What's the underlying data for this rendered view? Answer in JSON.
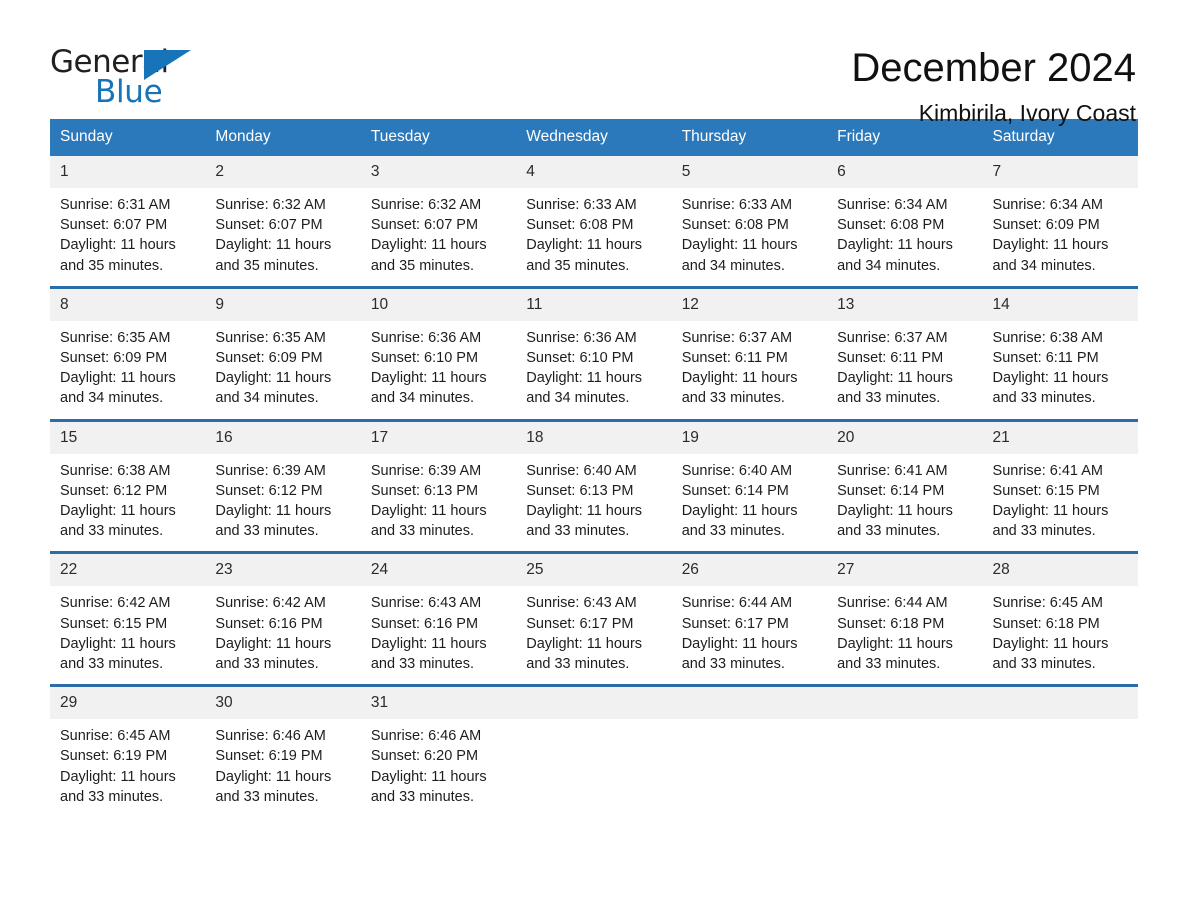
{
  "brand": {
    "name_part1": "General",
    "name_part2": "Blue",
    "triangle_icon": "triangle-icon",
    "accent_color": "#1874b8"
  },
  "header": {
    "title": "December 2024",
    "location": "Kimbirila, Ivory Coast"
  },
  "calendar": {
    "header_bg": "#2b78ba",
    "row_divider_color": "#2b6ca8",
    "daynum_bg": "#f1f1f1",
    "weekday_headers": [
      "Sunday",
      "Monday",
      "Tuesday",
      "Wednesday",
      "Thursday",
      "Friday",
      "Saturday"
    ],
    "weeks": [
      [
        {
          "day": "1",
          "sunrise": "Sunrise: 6:31 AM",
          "sunset": "Sunset: 6:07 PM",
          "daylight": "Daylight: 11 hours and 35 minutes."
        },
        {
          "day": "2",
          "sunrise": "Sunrise: 6:32 AM",
          "sunset": "Sunset: 6:07 PM",
          "daylight": "Daylight: 11 hours and 35 minutes."
        },
        {
          "day": "3",
          "sunrise": "Sunrise: 6:32 AM",
          "sunset": "Sunset: 6:07 PM",
          "daylight": "Daylight: 11 hours and 35 minutes."
        },
        {
          "day": "4",
          "sunrise": "Sunrise: 6:33 AM",
          "sunset": "Sunset: 6:08 PM",
          "daylight": "Daylight: 11 hours and 35 minutes."
        },
        {
          "day": "5",
          "sunrise": "Sunrise: 6:33 AM",
          "sunset": "Sunset: 6:08 PM",
          "daylight": "Daylight: 11 hours and 34 minutes."
        },
        {
          "day": "6",
          "sunrise": "Sunrise: 6:34 AM",
          "sunset": "Sunset: 6:08 PM",
          "daylight": "Daylight: 11 hours and 34 minutes."
        },
        {
          "day": "7",
          "sunrise": "Sunrise: 6:34 AM",
          "sunset": "Sunset: 6:09 PM",
          "daylight": "Daylight: 11 hours and 34 minutes."
        }
      ],
      [
        {
          "day": "8",
          "sunrise": "Sunrise: 6:35 AM",
          "sunset": "Sunset: 6:09 PM",
          "daylight": "Daylight: 11 hours and 34 minutes."
        },
        {
          "day": "9",
          "sunrise": "Sunrise: 6:35 AM",
          "sunset": "Sunset: 6:09 PM",
          "daylight": "Daylight: 11 hours and 34 minutes."
        },
        {
          "day": "10",
          "sunrise": "Sunrise: 6:36 AM",
          "sunset": "Sunset: 6:10 PM",
          "daylight": "Daylight: 11 hours and 34 minutes."
        },
        {
          "day": "11",
          "sunrise": "Sunrise: 6:36 AM",
          "sunset": "Sunset: 6:10 PM",
          "daylight": "Daylight: 11 hours and 34 minutes."
        },
        {
          "day": "12",
          "sunrise": "Sunrise: 6:37 AM",
          "sunset": "Sunset: 6:11 PM",
          "daylight": "Daylight: 11 hours and 33 minutes."
        },
        {
          "day": "13",
          "sunrise": "Sunrise: 6:37 AM",
          "sunset": "Sunset: 6:11 PM",
          "daylight": "Daylight: 11 hours and 33 minutes."
        },
        {
          "day": "14",
          "sunrise": "Sunrise: 6:38 AM",
          "sunset": "Sunset: 6:11 PM",
          "daylight": "Daylight: 11 hours and 33 minutes."
        }
      ],
      [
        {
          "day": "15",
          "sunrise": "Sunrise: 6:38 AM",
          "sunset": "Sunset: 6:12 PM",
          "daylight": "Daylight: 11 hours and 33 minutes."
        },
        {
          "day": "16",
          "sunrise": "Sunrise: 6:39 AM",
          "sunset": "Sunset: 6:12 PM",
          "daylight": "Daylight: 11 hours and 33 minutes."
        },
        {
          "day": "17",
          "sunrise": "Sunrise: 6:39 AM",
          "sunset": "Sunset: 6:13 PM",
          "daylight": "Daylight: 11 hours and 33 minutes."
        },
        {
          "day": "18",
          "sunrise": "Sunrise: 6:40 AM",
          "sunset": "Sunset: 6:13 PM",
          "daylight": "Daylight: 11 hours and 33 minutes."
        },
        {
          "day": "19",
          "sunrise": "Sunrise: 6:40 AM",
          "sunset": "Sunset: 6:14 PM",
          "daylight": "Daylight: 11 hours and 33 minutes."
        },
        {
          "day": "20",
          "sunrise": "Sunrise: 6:41 AM",
          "sunset": "Sunset: 6:14 PM",
          "daylight": "Daylight: 11 hours and 33 minutes."
        },
        {
          "day": "21",
          "sunrise": "Sunrise: 6:41 AM",
          "sunset": "Sunset: 6:15 PM",
          "daylight": "Daylight: 11 hours and 33 minutes."
        }
      ],
      [
        {
          "day": "22",
          "sunrise": "Sunrise: 6:42 AM",
          "sunset": "Sunset: 6:15 PM",
          "daylight": "Daylight: 11 hours and 33 minutes."
        },
        {
          "day": "23",
          "sunrise": "Sunrise: 6:42 AM",
          "sunset": "Sunset: 6:16 PM",
          "daylight": "Daylight: 11 hours and 33 minutes."
        },
        {
          "day": "24",
          "sunrise": "Sunrise: 6:43 AM",
          "sunset": "Sunset: 6:16 PM",
          "daylight": "Daylight: 11 hours and 33 minutes."
        },
        {
          "day": "25",
          "sunrise": "Sunrise: 6:43 AM",
          "sunset": "Sunset: 6:17 PM",
          "daylight": "Daylight: 11 hours and 33 minutes."
        },
        {
          "day": "26",
          "sunrise": "Sunrise: 6:44 AM",
          "sunset": "Sunset: 6:17 PM",
          "daylight": "Daylight: 11 hours and 33 minutes."
        },
        {
          "day": "27",
          "sunrise": "Sunrise: 6:44 AM",
          "sunset": "Sunset: 6:18 PM",
          "daylight": "Daylight: 11 hours and 33 minutes."
        },
        {
          "day": "28",
          "sunrise": "Sunrise: 6:45 AM",
          "sunset": "Sunset: 6:18 PM",
          "daylight": "Daylight: 11 hours and 33 minutes."
        }
      ],
      [
        {
          "day": "29",
          "sunrise": "Sunrise: 6:45 AM",
          "sunset": "Sunset: 6:19 PM",
          "daylight": "Daylight: 11 hours and 33 minutes."
        },
        {
          "day": "30",
          "sunrise": "Sunrise: 6:46 AM",
          "sunset": "Sunset: 6:19 PM",
          "daylight": "Daylight: 11 hours and 33 minutes."
        },
        {
          "day": "31",
          "sunrise": "Sunrise: 6:46 AM",
          "sunset": "Sunset: 6:20 PM",
          "daylight": "Daylight: 11 hours and 33 minutes."
        },
        {
          "day": "",
          "sunrise": "",
          "sunset": "",
          "daylight": ""
        },
        {
          "day": "",
          "sunrise": "",
          "sunset": "",
          "daylight": ""
        },
        {
          "day": "",
          "sunrise": "",
          "sunset": "",
          "daylight": ""
        },
        {
          "day": "",
          "sunrise": "",
          "sunset": "",
          "daylight": ""
        }
      ]
    ]
  }
}
